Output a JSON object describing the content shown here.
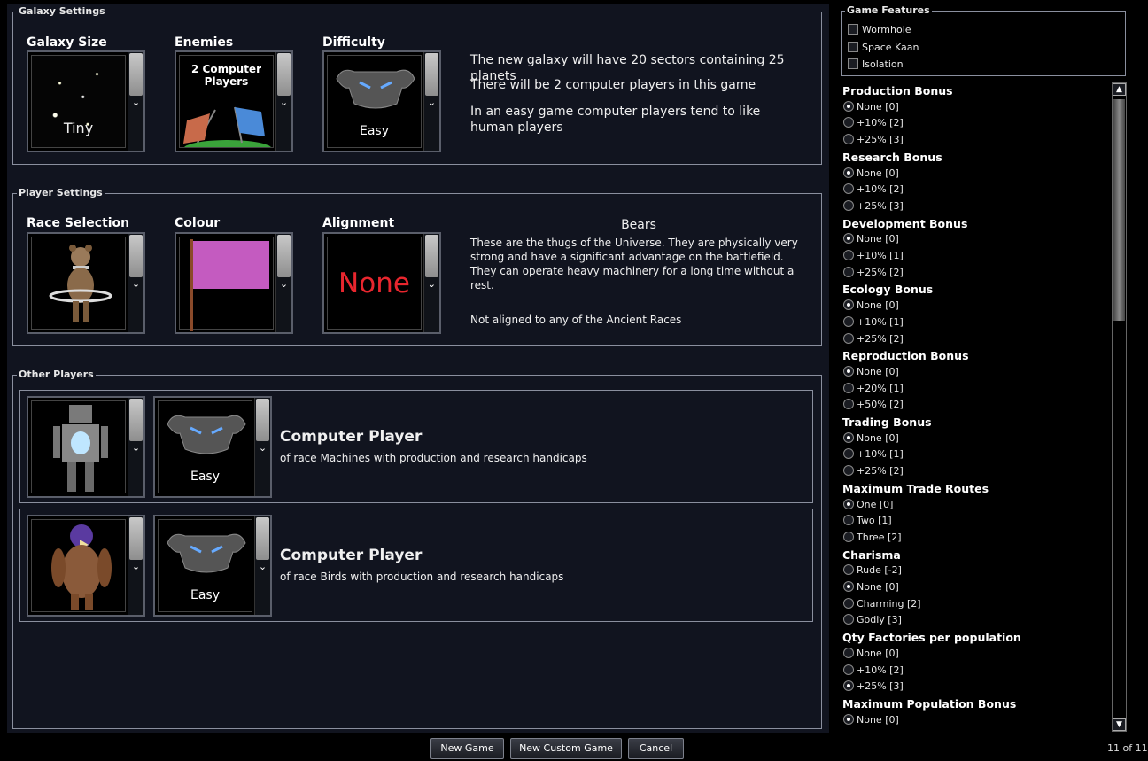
{
  "galaxy_settings": {
    "legend": "Galaxy Settings",
    "size": {
      "label": "Galaxy Size",
      "value": "Tiny"
    },
    "enemies": {
      "label": "Enemies",
      "value": "2 Computer Players"
    },
    "difficulty": {
      "label": "Difficulty",
      "value": "Easy"
    },
    "desc_lines": [
      "The new galaxy will have 20 sectors containing 25 planets",
      "There will be 2 computer players in this game",
      "In an easy game computer players tend to like human players"
    ]
  },
  "player_settings": {
    "legend": "Player Settings",
    "race": {
      "label": "Race Selection"
    },
    "colour": {
      "label": "Colour",
      "color": "#c45bc0"
    },
    "alignment": {
      "label": "Alignment",
      "value": "None"
    },
    "race_name": "Bears",
    "race_desc": "These are the thugs of the Universe. They are physically very strong and have a significant advantage on the battlefield. They can operate heavy machinery for a long time without a rest.",
    "alignment_desc": "Not aligned to any of the Ancient Races"
  },
  "other_players": {
    "legend": "Other Players",
    "players": [
      {
        "title": "Computer Player",
        "difficulty": "Easy",
        "desc": "of race Machines with production and research handicaps"
      },
      {
        "title": "Computer Player",
        "difficulty": "Easy",
        "desc": "of race Birds with production and research handicaps"
      }
    ]
  },
  "buttons": {
    "new_game": "New Game",
    "new_custom_game": "New Custom Game",
    "cancel": "Cancel"
  },
  "game_features": {
    "legend": "Game Features",
    "items": [
      "Wormhole",
      "Space Kaan",
      "Isolation"
    ]
  },
  "bonuses": [
    {
      "title": "Production Bonus",
      "options": [
        "None [0]",
        "+10% [2]",
        "+25% [3]"
      ],
      "selected": 0
    },
    {
      "title": "Research Bonus",
      "options": [
        "None [0]",
        "+10% [2]",
        "+25% [3]"
      ],
      "selected": 0
    },
    {
      "title": "Development Bonus",
      "options": [
        "None [0]",
        "+10% [1]",
        "+25% [2]"
      ],
      "selected": 0
    },
    {
      "title": "Ecology Bonus",
      "options": [
        "None [0]",
        "+10% [1]",
        "+25% [2]"
      ],
      "selected": 0
    },
    {
      "title": "Reproduction Bonus",
      "options": [
        "None [0]",
        "+20% [1]",
        "+50% [2]"
      ],
      "selected": 0
    },
    {
      "title": "Trading Bonus",
      "options": [
        "None [0]",
        "+10% [1]",
        "+25% [2]"
      ],
      "selected": 0
    },
    {
      "title": "Maximum Trade Routes",
      "options": [
        "One [0]",
        "Two [1]",
        "Three [2]"
      ],
      "selected": 0
    },
    {
      "title": "Charisma",
      "options": [
        "Rude [-2]",
        "None [0]",
        "Charming [2]",
        "Godly [3]"
      ],
      "selected": 1
    },
    {
      "title": "Qty Factories per population",
      "options": [
        "None [0]",
        "+10% [2]",
        "+25% [3]"
      ],
      "selected": 2
    },
    {
      "title": "Maximum Population Bonus",
      "options": [
        "None [0]"
      ],
      "selected": 0
    }
  ],
  "page_indicator": "11 of 11",
  "icons": {
    "dropdown": "chevron-down-icon",
    "scroll_up": "arrow-up-icon",
    "scroll_down": "arrow-down-icon"
  }
}
